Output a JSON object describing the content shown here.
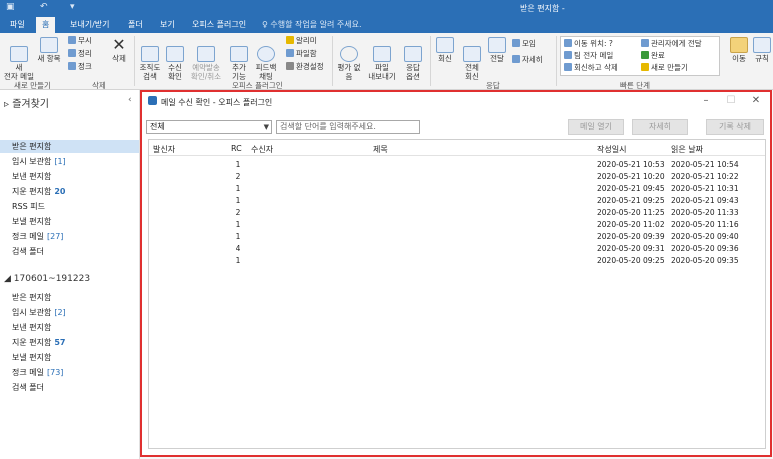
{
  "window": {
    "title": "받은 편지함 -"
  },
  "menu_tabs": [
    {
      "label": "파일"
    },
    {
      "label": "홈"
    },
    {
      "label": "보내기/받기"
    },
    {
      "label": "폴더"
    },
    {
      "label": "보기"
    },
    {
      "label": "오피스 플러그인"
    }
  ],
  "tell_me": "수행할 작업을 알려 주세요.",
  "ribbon": {
    "new_email": "새\n전자 메일",
    "new_items": "새 항목",
    "ignore": "무시",
    "cleanup": "정리",
    "junk": "정크",
    "delete": "삭제",
    "org_search": "조직도\n검색",
    "receipt_check": "수신\n확인",
    "reserve_cancel": "예약발송\n확인/취소",
    "add_func": "추가\n기능",
    "feedback_chat": "피드백\n채팅",
    "notify": "알리미",
    "file_box": "파일함",
    "env_settings": "환경설정",
    "rate": "평가 없\n음",
    "file_export": "파일\n내보내기",
    "reply_options": "응답\n옵션",
    "reply": "회신",
    "reply_all": "전체\n회신",
    "forward": "전달",
    "meeting": "모임",
    "more": "자세히",
    "quick_steps": [
      "이동 위치: ?",
      "팀 전자 메일",
      "회신하고 삭제",
      "관리자에게 전달",
      "완료",
      "새로 만들기"
    ],
    "move": "이동",
    "rules": "규칙",
    "groups": [
      "새로 만들기",
      "삭제",
      "오피스 플러그인",
      "응답",
      "빠른 단계"
    ]
  },
  "sidebar": {
    "favorites": "즐겨찾기",
    "items": [
      {
        "label": "받은 편지함",
        "count": ""
      },
      {
        "label": "임시 보관함",
        "count": "[1]"
      },
      {
        "label": "보낸 편지함",
        "count": ""
      },
      {
        "label": "지운 편지함",
        "count": "20"
      },
      {
        "label": "RSS 피드",
        "count": ""
      },
      {
        "label": "보낼 편지함",
        "count": ""
      },
      {
        "label": "정크 메일",
        "count": "[27]"
      },
      {
        "label": "검색 폴더",
        "count": ""
      }
    ],
    "account": "170601~191223",
    "account_items": [
      {
        "label": "받은 편지함",
        "count": ""
      },
      {
        "label": "임시 보관함",
        "count": "[2]"
      },
      {
        "label": "보낸 편지함",
        "count": ""
      },
      {
        "label": "지운 편지함",
        "count": "57"
      },
      {
        "label": "보낼 편지함",
        "count": ""
      },
      {
        "label": "정크 메일",
        "count": "[73]"
      },
      {
        "label": "검색 폴더",
        "count": ""
      }
    ]
  },
  "dialog": {
    "title": "메일 수신 확인 - 오피스 플러그인",
    "filter_value": "전체",
    "search_placeholder": "검색할 단어를 입력해주세요.",
    "buttons": {
      "open_mail": "메일 열기",
      "detail": "자세히",
      "cancel_record": "기록 삭제"
    },
    "columns": {
      "sender": "발신자",
      "rc": "RC",
      "recipient": "수신자",
      "subject": "제목",
      "sent": "작성일시",
      "read": "읽은 날짜"
    },
    "rows": [
      {
        "rc": "1",
        "sent": "2020-05-21 10:53",
        "read": "2020-05-21 10:54"
      },
      {
        "rc": "2",
        "sent": "2020-05-21 10:20",
        "read": "2020-05-21 10:22"
      },
      {
        "rc": "1",
        "sent": "2020-05-21 09:45",
        "read": "2020-05-21 10:31"
      },
      {
        "rc": "1",
        "sent": "2020-05-21 09:25",
        "read": "2020-05-21 09:43"
      },
      {
        "rc": "2",
        "sent": "2020-05-20 11:25",
        "read": "2020-05-20 11:33"
      },
      {
        "rc": "1",
        "sent": "2020-05-20 11:02",
        "read": "2020-05-20 11:16"
      },
      {
        "rc": "1",
        "sent": "2020-05-20 09:39",
        "read": "2020-05-20 09:40"
      },
      {
        "rc": "4",
        "sent": "2020-05-20 09:31",
        "read": "2020-05-20 09:36"
      },
      {
        "rc": "1",
        "sent": "2020-05-20 09:25",
        "read": "2020-05-20 09:35"
      }
    ]
  }
}
